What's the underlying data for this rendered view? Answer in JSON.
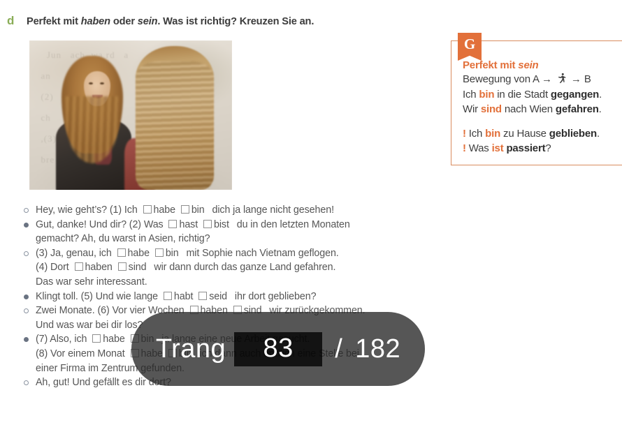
{
  "task": {
    "letter": "d",
    "instruction_pre": "Perfekt mit ",
    "instruction_it1": "haben",
    "instruction_mid": " oder ",
    "instruction_it2": "sein",
    "instruction_post": ". Was ist richtig? Kreuzen Sie an."
  },
  "photo": {
    "alt": "Two young women with long curly hair talking outdoors",
    "ghost_text": "    Jun   ach  wa rd   a\n  an        u   ri  bei\n  (2)       e   So\n  ch        e      ib\n  ,(3)       nd\n  bre"
  },
  "grammar": {
    "badge": "G",
    "title_pre": "Perfekt mit ",
    "title_it": "sein",
    "line_motion_pre": "Bewegung von A ",
    "line_motion_arrow1": "→",
    "line_motion_icon": "running-person-icon",
    "line_motion_arrow2": "→",
    "line_motion_post": " B",
    "line2": {
      "a": "Ich ",
      "hl": "bin",
      "b": " in die Stadt ",
      "bold": "gegangen",
      "c": "."
    },
    "line3": {
      "a": "Wir ",
      "hl": "sind",
      "b": " nach Wien ",
      "bold": "gefahren",
      "c": "."
    },
    "line4": {
      "excl": "!",
      "a": " Ich ",
      "hl": "bin",
      "b": " zu Hause ",
      "bold": "geblieben",
      "c": "."
    },
    "line5": {
      "excl": "!",
      "a": " Was ",
      "hl": "ist",
      "b": " ",
      "bold": "passiert",
      "c": "?"
    },
    "colors": {
      "accent": "#e2703a",
      "border": "#d98c5f"
    }
  },
  "dialogue": {
    "lines": [
      {
        "bullet": "open",
        "segments": [
          {
            "t": "text",
            "v": "Hey, wie geht’s? (1) Ich"
          },
          {
            "t": "checkbox"
          },
          {
            "t": "text",
            "v": "habe"
          },
          {
            "t": "checkbox"
          },
          {
            "t": "text",
            "v": "bin"
          },
          {
            "t": "gap"
          },
          {
            "t": "text",
            "v": "dich ja lange nicht gesehen!"
          }
        ]
      },
      {
        "bullet": "filled",
        "segments": [
          {
            "t": "text",
            "v": "Gut, danke! Und dir? (2) Was"
          },
          {
            "t": "checkbox"
          },
          {
            "t": "text",
            "v": "hast"
          },
          {
            "t": "checkbox"
          },
          {
            "t": "text",
            "v": "bist"
          },
          {
            "t": "gap"
          },
          {
            "t": "text",
            "v": "du in den letzten Monaten"
          }
        ],
        "continuation": "gemacht? Ah, du warst in Asien, richtig?"
      },
      {
        "bullet": "open",
        "segments": [
          {
            "t": "text",
            "v": "(3) Ja, genau, ich"
          },
          {
            "t": "checkbox"
          },
          {
            "t": "text",
            "v": "habe"
          },
          {
            "t": "checkbox"
          },
          {
            "t": "text",
            "v": "bin"
          },
          {
            "t": "gap"
          },
          {
            "t": "text",
            "v": "mit Sophie nach Vietnam geflogen."
          }
        ],
        "continuation_segments": [
          {
            "t": "text",
            "v": "(4) Dort"
          },
          {
            "t": "checkbox"
          },
          {
            "t": "text",
            "v": "haben"
          },
          {
            "t": "checkbox"
          },
          {
            "t": "text",
            "v": "sind"
          },
          {
            "t": "gap"
          },
          {
            "t": "text",
            "v": "wir dann durch das ganze Land gefahren."
          }
        ],
        "continuation2": "Das war sehr interessant."
      },
      {
        "bullet": "filled",
        "segments": [
          {
            "t": "text",
            "v": "Klingt toll. (5) Und wie lange"
          },
          {
            "t": "checkbox"
          },
          {
            "t": "text",
            "v": "habt"
          },
          {
            "t": "checkbox"
          },
          {
            "t": "text",
            "v": "seid"
          },
          {
            "t": "gap"
          },
          {
            "t": "text",
            "v": "ihr dort geblieben?"
          }
        ]
      },
      {
        "bullet": "open",
        "segments": [
          {
            "t": "text",
            "v": "Zwei Monate. (6) Vor vier Wochen"
          },
          {
            "t": "checkbox"
          },
          {
            "t": "text",
            "v": "haben"
          },
          {
            "t": "checkbox"
          },
          {
            "t": "text",
            "v": "sind"
          },
          {
            "t": "gap"
          },
          {
            "t": "text",
            "v": "wir zurückgekommen."
          }
        ],
        "continuation": "Und was war bei dir los?"
      },
      {
        "bullet": "filled",
        "segments": [
          {
            "t": "text",
            "v": "(7) Also, ich"
          },
          {
            "t": "checkbox"
          },
          {
            "t": "text",
            "v": "habe"
          },
          {
            "t": "checkbox"
          },
          {
            "t": "text",
            "v": "bin"
          },
          {
            "t": "gap"
          },
          {
            "t": "text",
            "v": "ja lange eine neue Arbeit gesucht."
          }
        ],
        "continuation_segments": [
          {
            "t": "text",
            "v": "(8) Vor einem Monat"
          },
          {
            "t": "checkbox"
          },
          {
            "t": "text",
            "v": "habe"
          },
          {
            "t": "checkbox"
          },
          {
            "t": "text",
            "v": "bin"
          },
          {
            "t": "gap"
          },
          {
            "t": "text",
            "v": "ich dann auch endlich eine Stelle bei"
          }
        ],
        "continuation2": "einer Firma im Zentrum gefunden."
      },
      {
        "bullet": "open",
        "segments": [
          {
            "t": "text",
            "v": "Ah, gut! Und gefällt es dir dort?"
          }
        ]
      }
    ]
  },
  "page_overlay": {
    "label": "Trang",
    "current": "83",
    "separator": "/",
    "total": "182"
  }
}
